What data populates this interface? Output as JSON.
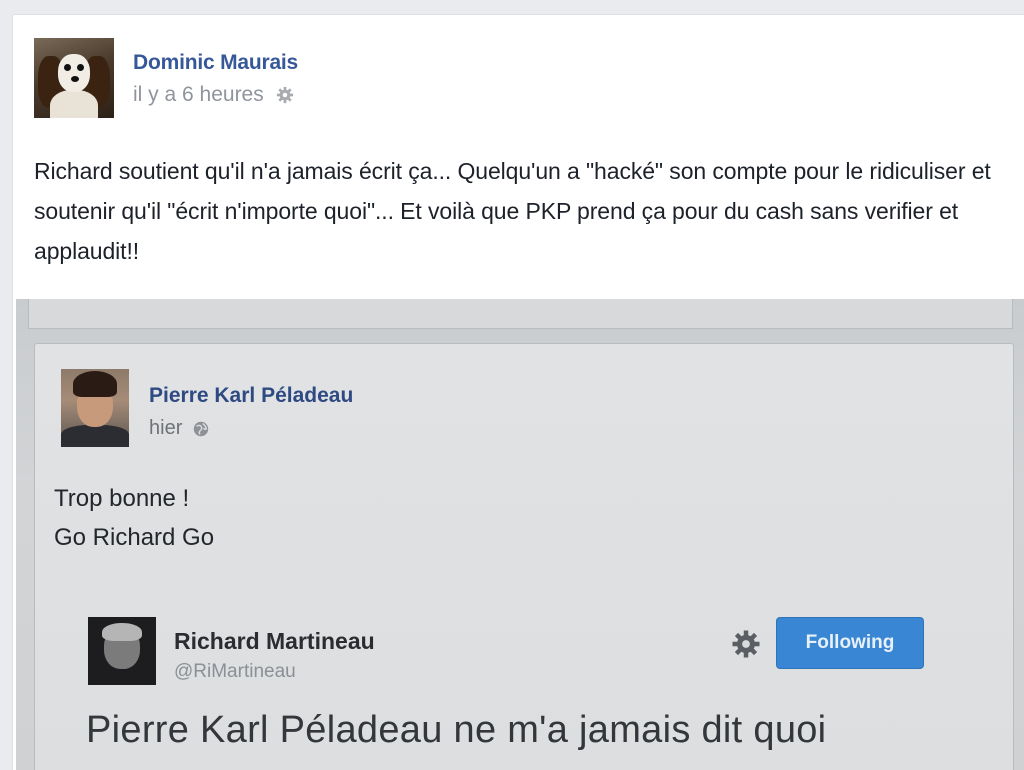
{
  "post": {
    "author": "Dominic Maurais",
    "time": "il y a 6 heures",
    "privacy_icon": "gear-icon",
    "text": "Richard soutient qu'il n'a jamais écrit ça... Quelqu'un a \"hacké\" son compte pour le ridiculiser et soutenir qu'il \"écrit n'importe quoi\"... Et voilà que PKP prend ça pour du cash sans verifier et applaudit!!"
  },
  "photo": {
    "fb_post": {
      "author": "Pierre Karl Péladeau",
      "time": "hier",
      "privacy_icon": "globe-icon",
      "lines": [
        "Trop bonne !",
        "Go Richard Go"
      ]
    },
    "tweet": {
      "name": "Richard Martineau",
      "handle": "@RiMartineau",
      "follow_label": "Following",
      "text": "Pierre Karl Péladeau ne m'a jamais dit quoi"
    }
  },
  "colors": {
    "link": "#365899",
    "meta": "#90949c",
    "twitter_button": "#3987d4"
  }
}
